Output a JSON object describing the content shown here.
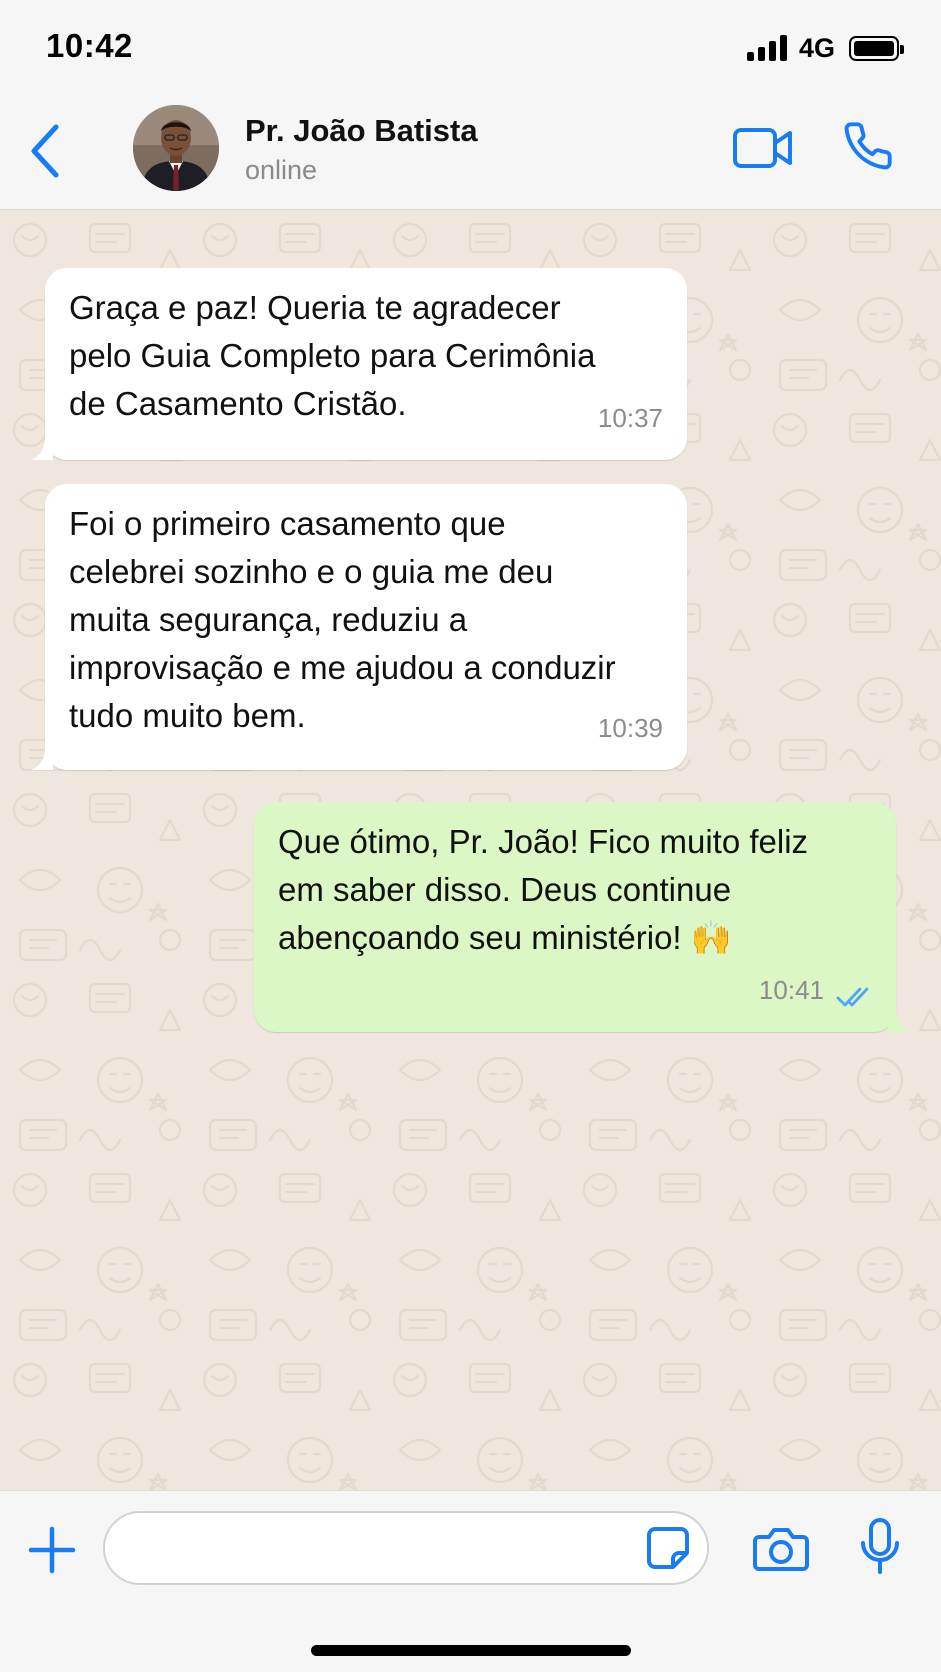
{
  "status_bar": {
    "time": "10:42",
    "network": "4G",
    "icons": [
      "signal-bars-icon",
      "battery-icon"
    ]
  },
  "header": {
    "contact_name": "Pr. João Batista",
    "contact_status": "online",
    "icons": [
      "chevron-left-icon",
      "avatar-photo",
      "video-camera-icon",
      "phone-icon"
    ]
  },
  "messages": [
    {
      "direction": "incoming",
      "text": "Graça e paz! Queria te agradecer\npelo Guia Completo para Cerimônia\nde Casamento Cristão.",
      "time": "10:37"
    },
    {
      "direction": "incoming",
      "text": "Foi o primeiro casamento que\ncelebrei sozinho e o guia me deu\nmuita segurança, reduziu a\nimprovisação e me ajudou a conduzir\ntudo muito bem.",
      "time": "10:39"
    },
    {
      "direction": "outgoing",
      "text": "Que ótimo, Pr. João! Fico muito feliz\nem saber disso. Deus continue\nabençoando seu ministério! 🙌",
      "time": "10:41",
      "status": "read",
      "status_icon": "double-check-icon"
    }
  ],
  "input_bar": {
    "value": "",
    "placeholder": "",
    "icons": [
      "plus-icon",
      "sticker-icon",
      "camera-icon",
      "microphone-icon"
    ]
  },
  "colors": {
    "accent": "#1a7cf5",
    "chat_background": "#efe7dd",
    "incoming_bubble": "#ffffff",
    "outgoing_bubble": "#dbf7c6",
    "read_ticks": "#4fa6f5",
    "timestamp": "#8c8c8c"
  }
}
